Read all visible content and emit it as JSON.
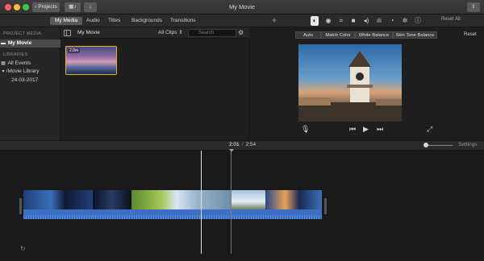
{
  "window": {
    "title": "My Movie"
  },
  "titlebar": {
    "projects_label": "Projects"
  },
  "tabs": [
    {
      "label": "My Media",
      "active": true
    },
    {
      "label": "Audio",
      "active": false
    },
    {
      "label": "Titles",
      "active": false
    },
    {
      "label": "Backgrounds",
      "active": false
    },
    {
      "label": "Transitions",
      "active": false
    }
  ],
  "adjust_tools": [
    "magic-wand-icon",
    "color-balance-icon",
    "color-correction-icon",
    "crop-icon",
    "stabilization-icon",
    "volume-icon",
    "equalizer-icon",
    "speed-icon",
    "noise-reduction-icon",
    "info-icon"
  ],
  "reset_all_label": "Reset All",
  "sidebar": {
    "project_media_heading": "PROJECT MEDIA",
    "project_item": "My Movie",
    "libraries_heading": "LIBRARIES",
    "all_events": "All Events",
    "library_name": "iMovie Library",
    "event_date": "24-03-2017"
  },
  "browser": {
    "title": "My Movie",
    "filter": "All Clips",
    "search_placeholder": "Search",
    "clip_duration": "2.0m"
  },
  "viewer": {
    "color_buttons": [
      "Auto",
      "Match Color",
      "White Balance",
      "Skin Tone Balance"
    ],
    "reset_label": "Reset"
  },
  "timeline": {
    "current_time": "2:01",
    "separator": "/",
    "total_time": "2:54",
    "settings_label": "Settings"
  },
  "colors": {
    "accent": "#f0c000",
    "audio": "#3a6fc2",
    "selection": "#4a4a4a"
  }
}
